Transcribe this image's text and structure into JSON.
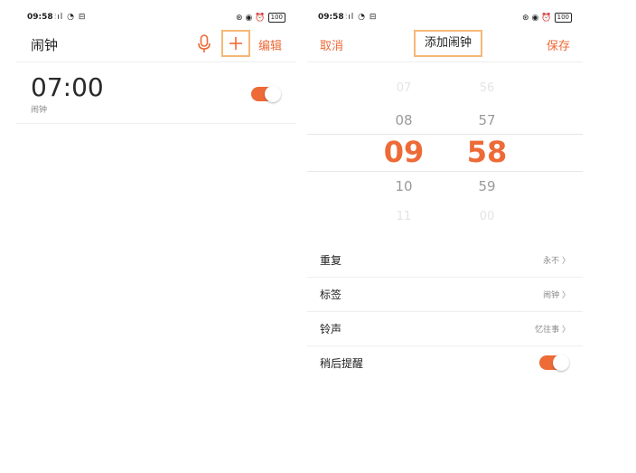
{
  "left": {
    "status": {
      "time": "09:58",
      "signal": "⫶ıl ◔ ⊟",
      "battery": "100"
    },
    "header": {
      "title": "闹钟",
      "edit_label": "编辑"
    },
    "alarms": [
      {
        "time": "07:00",
        "label": "闹钟",
        "enabled": true
      }
    ]
  },
  "right": {
    "status": {
      "time": "09:58",
      "signal": "⫶ıl ◔ ⊟",
      "battery": "100"
    },
    "header": {
      "cancel_label": "取消",
      "title": "添加闹钟",
      "save_label": "保存"
    },
    "picker": {
      "hours": [
        "07",
        "08",
        "09",
        "10",
        "11"
      ],
      "minutes": [
        "56",
        "57",
        "58",
        "59",
        "00"
      ],
      "selected_hour": "09",
      "selected_minute": "58"
    },
    "settings": [
      {
        "label": "重复",
        "value": "永不 〉"
      },
      {
        "label": "标签",
        "value": "闹钟 〉"
      },
      {
        "label": "铃声",
        "value": "忆往事 〉"
      },
      {
        "label": "稍后提醒",
        "toggle": true
      }
    ]
  },
  "colors": {
    "accent": "#ee6a36",
    "highlight_box": "#f5b877"
  }
}
